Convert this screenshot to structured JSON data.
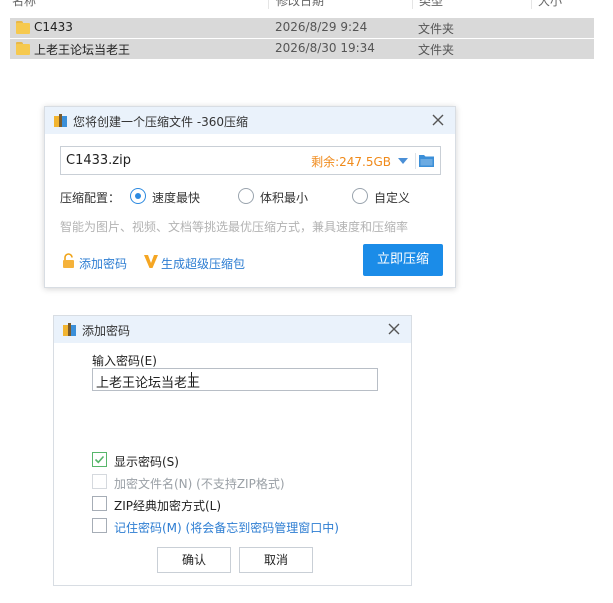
{
  "explorer": {
    "columns": [
      "名称",
      "修改日期",
      "类型",
      "大小"
    ],
    "rows": [
      {
        "name": "C1433",
        "date": "2026/8/29 9:24",
        "type": "文件夹"
      },
      {
        "name": "上老王论坛当老王",
        "date": "2026/8/30 19:34",
        "type": "文件夹"
      }
    ]
  },
  "compress_dialog": {
    "title": "您将创建一个压缩文件 -360压缩",
    "filename": "C1433.zip",
    "free_space": "剩余:247.5GB",
    "config_label": "压缩配置：",
    "options": [
      {
        "label": "速度最快",
        "checked": true
      },
      {
        "label": "体积最小",
        "checked": false
      },
      {
        "label": "自定义",
        "checked": false
      }
    ],
    "hint": "智能为图片、视频、文档等挑选最优压缩方式，兼具速度和压缩率",
    "add_password": "添加密码",
    "super_pack": "生成超级压缩包",
    "compress_now": "立即压缩"
  },
  "password_dialog": {
    "title": "添加密码",
    "input_label": "输入密码(E)",
    "password_value": "上老王论坛当老王",
    "options": [
      {
        "label": "显示密码(S)",
        "checked": true,
        "disabled": false
      },
      {
        "label": "加密文件名(N) (不支持ZIP格式)",
        "checked": false,
        "disabled": true
      },
      {
        "label": "ZIP经典加密方式(L)",
        "checked": false,
        "disabled": false
      },
      {
        "label": "记住密码(M) (将会备忘到密码管理窗口中)",
        "checked": false,
        "disabled": false
      }
    ],
    "ok": "确认",
    "cancel": "取消"
  },
  "colors": {
    "accent": "#1b8ce8",
    "free_space": "#f08a1a",
    "link": "#2d7dd2",
    "titlebar": "#eaf2fb"
  }
}
